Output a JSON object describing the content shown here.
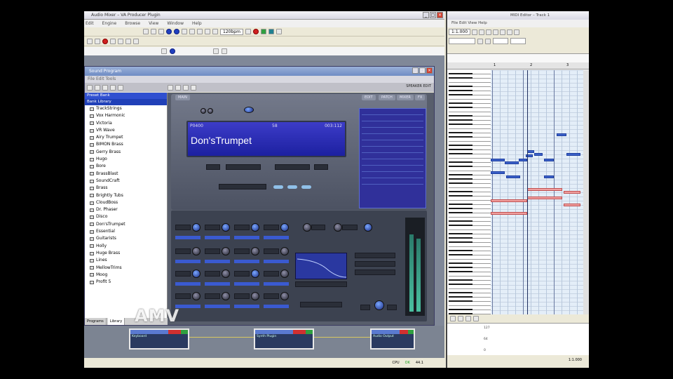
{
  "host": {
    "title": "Audio Mixer – VA Producer Plugin",
    "menu": [
      "Edit",
      "Engine",
      "Browse",
      "View",
      "Window",
      "Help"
    ],
    "tempo_field": "120bpm"
  },
  "plugin": {
    "title": "Sound Program",
    "menu": "File  Edit  Tools",
    "brand": "SPEAKER EDIT",
    "tabs": [
      "EDIT",
      "PATCH",
      "MIXER",
      "FX"
    ],
    "preset_list_header_1": "Preset Bank",
    "preset_list_header_2": "Bank Library",
    "presets": [
      "TrackStrings",
      "Vox Harmonic",
      "Victoria",
      "VR Wave",
      "Airy Trumpet",
      "BIMON Brass",
      "Gerry Brass",
      "Hugo",
      "Bore",
      "BrassBlast",
      "SoundCraft",
      "Brass",
      "Brightly Tubs",
      "CloudBoss",
      "Dr. Phaser",
      "Disco",
      "Don'sTrumpet",
      "Essential",
      "Guitarists",
      "Holly",
      "Huge Brass",
      "Lines",
      "MellowTrims",
      "Moog",
      "Profit 5"
    ],
    "list_tabs": [
      "Programs",
      "Library"
    ],
    "lcd": {
      "number": "P0400",
      "bank": "58",
      "position": "003:112",
      "patch_name": "Don'sTrumpet"
    }
  },
  "nodes": [
    {
      "name": "Keyboard"
    },
    {
      "name": "Synth Plugin"
    },
    {
      "name": "Audio Output"
    }
  ],
  "watermark": "AMV",
  "host_status": {
    "cpu": "CPU",
    "ok": "OK",
    "sr": "44.1"
  },
  "roll": {
    "title": "MIDI Editor – Track 1",
    "menu": "File  Edit  View  Help",
    "tempo": "1:1.000",
    "ruler": [
      "1",
      "2",
      "3"
    ],
    "status": "1:1.000"
  }
}
